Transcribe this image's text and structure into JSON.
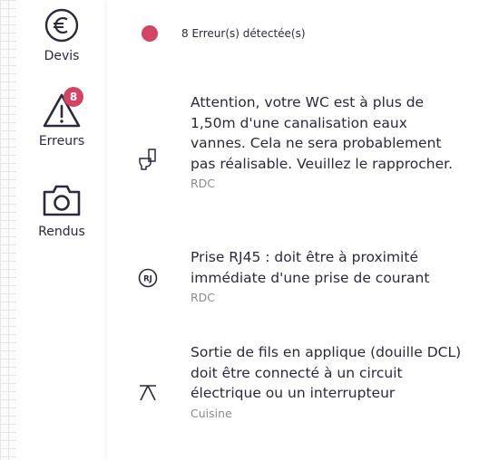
{
  "sidebar": {
    "items": [
      {
        "label": "Devis",
        "icon": "euro-icon"
      },
      {
        "label": "Erreurs",
        "icon": "warning-icon",
        "badge": "8",
        "active": true
      },
      {
        "label": "Rendus",
        "icon": "camera-icon"
      }
    ]
  },
  "main": {
    "summary": "8 Erreur(s) détectée(s)",
    "errors": [
      {
        "icon": "toilet-icon",
        "message": "Attention, votre WC est à plus de 1,50m d'une canalisation eaux vannes. Cela ne sera probablement pas réalisable. Veuillez le rapprocher.",
        "room": "RDC"
      },
      {
        "icon": "rj45-icon",
        "icon_text": "RJ",
        "message": "Prise RJ45 : doit être à proximité immédiate d'une prise de courant",
        "room": "RDC"
      },
      {
        "icon": "ceiling-light-icon",
        "message": "Sortie de fils en applique (douille DCL) doit être connecté à un circuit électrique ou un interrupteur",
        "room": "Cuisine"
      }
    ]
  },
  "colors": {
    "accent": "#d24464",
    "text": "#2a2a3a",
    "muted": "#8a8a8a"
  }
}
